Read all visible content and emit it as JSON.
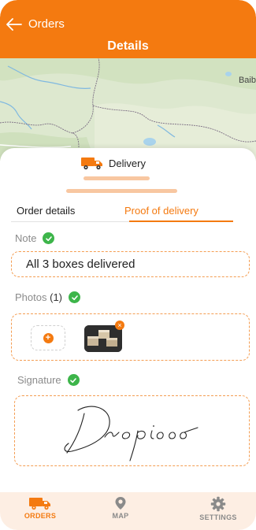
{
  "header": {
    "back_label": "Orders",
    "title": "Details"
  },
  "map": {
    "place_label": "Baib"
  },
  "delivery": {
    "heading": "Delivery"
  },
  "tabs": [
    {
      "label": "Order details",
      "active": false
    },
    {
      "label": "Proof of delivery",
      "active": true
    }
  ],
  "note": {
    "label": "Note",
    "value": "All 3 boxes delivered"
  },
  "photos": {
    "label": "Photos",
    "count": "(1)"
  },
  "signature": {
    "label": "Signature",
    "signed_text": "Dropioo"
  },
  "bottom_nav": [
    {
      "label": "ORDERS",
      "icon": "truck-icon",
      "active": true
    },
    {
      "label": "MAP",
      "icon": "map-pin-icon",
      "active": false
    },
    {
      "label": "SETTINGS",
      "icon": "gear-icon",
      "active": false
    }
  ],
  "colors": {
    "accent": "#F47A10",
    "success": "#3DB54A",
    "nav_bg": "#FDEEE3"
  }
}
